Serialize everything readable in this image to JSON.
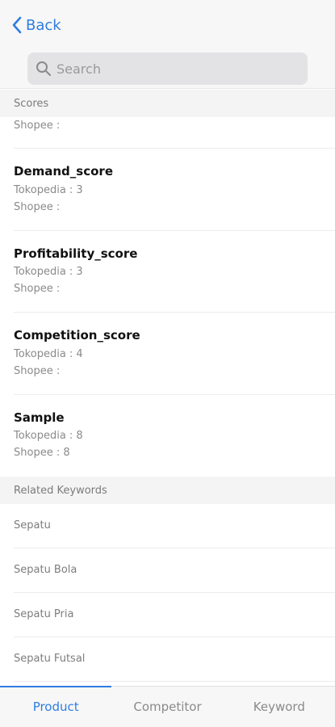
{
  "header": {
    "back_label": "Back",
    "search_placeholder": "Search"
  },
  "scores_section": {
    "heading": "Scores",
    "partial_line": "Shopee :",
    "items": [
      {
        "name": "Demand_score",
        "tokopedia": "Tokopedia : 3",
        "shopee": "Shopee :"
      },
      {
        "name": "Profitability_score",
        "tokopedia": "Tokopedia : 3",
        "shopee": "Shopee :"
      },
      {
        "name": "Competition_score",
        "tokopedia": "Tokopedia : 4",
        "shopee": "Shopee :"
      },
      {
        "name": "Sample",
        "tokopedia": "Tokopedia : 8",
        "shopee": "Shopee : 8"
      }
    ]
  },
  "keywords_section": {
    "heading": "Related Keywords",
    "items": [
      "Sepatu",
      "Sepatu Bola",
      "Sepatu Pria",
      "Sepatu Futsal"
    ]
  },
  "tabs": [
    {
      "label": "Product",
      "active": true
    },
    {
      "label": "Competitor",
      "active": false
    },
    {
      "label": "Keyword",
      "active": false
    }
  ],
  "colors": {
    "accent": "#2f7de1"
  }
}
